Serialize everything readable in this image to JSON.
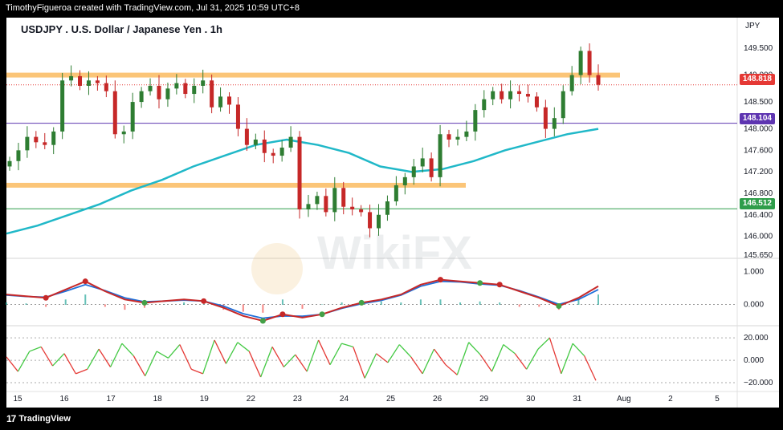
{
  "header": {
    "credit": "TimothyFigueroa created with TradingView.com, Jul 31, 2025 10:59 UTC+8"
  },
  "footer": {
    "logo_mark": "17",
    "logo_text": "TradingView"
  },
  "colors": {
    "bull": "#2e7d32",
    "bear": "#c62828",
    "ma": "#20b8c8",
    "zone": "#fbbf69",
    "purple": "#5e35b1",
    "green_line": "#2e9d4a",
    "current": "#e53935",
    "macd_blue": "#1e6fd9",
    "macd_red": "#c62828",
    "macd_green_dot": "#43a047",
    "rsi_green": "#43c943",
    "rsi_red": "#e53935"
  },
  "chart_data": {
    "type": "candlestick",
    "title": "USDJPY . U.S. Dollar / Japanese Yen . 1h",
    "currency": "JPY",
    "ylim": [
      145.65,
      149.8
    ],
    "y_ticks": [
      "149.500",
      "149.000",
      "148.500",
      "148.000",
      "147.600",
      "147.200",
      "146.800",
      "146.400",
      "146.000",
      "145.650"
    ],
    "x_ticks": [
      "15",
      "16",
      "17",
      "18",
      "19",
      "22",
      "23",
      "24",
      "25",
      "26",
      "29",
      "30",
      "31",
      "Aug",
      "2",
      "5"
    ],
    "price_labels": [
      {
        "name": "current",
        "value": "148.818"
      },
      {
        "name": "purple-line",
        "value": "148.104"
      },
      {
        "name": "green-line",
        "value": "146.512"
      }
    ],
    "zones": [
      {
        "name": "resistance-zone",
        "price": 149.0
      },
      {
        "name": "support-zone",
        "price": 146.95
      }
    ],
    "closes": [
      147.4,
      147.6,
      147.85,
      147.75,
      147.7,
      147.95,
      148.9,
      148.98,
      148.8,
      148.9,
      148.85,
      148.7,
      147.9,
      147.95,
      148.5,
      148.7,
      148.8,
      148.55,
      148.75,
      148.85,
      148.65,
      148.8,
      148.9,
      148.4,
      148.6,
      148.45,
      148.0,
      147.7,
      147.8,
      147.55,
      147.5,
      147.65,
      147.85,
      146.5,
      146.6,
      146.75,
      146.45,
      146.9,
      146.55,
      146.5,
      146.45,
      146.15,
      146.4,
      146.65,
      146.95,
      147.1,
      147.3,
      147.45,
      147.1,
      147.9,
      147.8,
      147.85,
      147.95,
      148.35,
      148.55,
      148.7,
      148.55,
      148.7,
      148.65,
      148.6,
      148.4,
      148.0,
      148.2,
      148.7,
      149.0,
      149.45,
      149.0,
      148.82
    ],
    "ma_values": [
      146.05,
      146.2,
      146.4,
      146.6,
      146.85,
      147.05,
      147.3,
      147.5,
      147.7,
      147.8,
      147.7,
      147.55,
      147.3,
      147.2,
      147.25,
      147.4,
      147.6,
      147.75,
      147.9,
      148.0
    ],
    "macd": {
      "ylim": [
        -0.5,
        1.3
      ],
      "y_ticks": [
        "1.000",
        "0.000"
      ],
      "fast": [
        0.3,
        0.25,
        0.2,
        0.45,
        0.7,
        0.4,
        0.15,
        0.05,
        0.1,
        0.15,
        0.1,
        -0.1,
        -0.35,
        -0.5,
        -0.3,
        -0.4,
        -0.3,
        -0.1,
        0.05,
        0.15,
        0.3,
        0.6,
        0.75,
        0.7,
        0.65,
        0.6,
        0.4,
        0.2,
        -0.05,
        0.2,
        0.55
      ],
      "slow": [
        0.28,
        0.24,
        0.22,
        0.4,
        0.6,
        0.42,
        0.2,
        0.08,
        0.1,
        0.13,
        0.1,
        -0.05,
        -0.28,
        -0.42,
        -0.35,
        -0.36,
        -0.3,
        -0.12,
        0.02,
        0.12,
        0.28,
        0.55,
        0.7,
        0.68,
        0.62,
        0.58,
        0.42,
        0.22,
        0.0,
        0.15,
        0.45
      ],
      "dots": [
        {
          "i": 2,
          "color": "red"
        },
        {
          "i": 4,
          "color": "red"
        },
        {
          "i": 7,
          "color": "green"
        },
        {
          "i": 10,
          "color": "red"
        },
        {
          "i": 13,
          "color": "green"
        },
        {
          "i": 14,
          "color": "red"
        },
        {
          "i": 16,
          "color": "green"
        },
        {
          "i": 18,
          "color": "green"
        },
        {
          "i": 22,
          "color": "red"
        },
        {
          "i": 24,
          "color": "green"
        },
        {
          "i": 25,
          "color": "red"
        },
        {
          "i": 28,
          "color": "green"
        }
      ]
    },
    "oscillator": {
      "ylim": [
        -25,
        28
      ],
      "y_ticks": [
        "20.000",
        "0.000",
        "−20.000"
      ],
      "values": [
        3,
        -10,
        8,
        12,
        -5,
        6,
        -12,
        -8,
        10,
        -6,
        15,
        4,
        -14,
        8,
        2,
        14,
        -8,
        -12,
        18,
        -3,
        16,
        8,
        -15,
        12,
        -6,
        5,
        -10,
        18,
        -4,
        15,
        12,
        -16,
        6,
        -2,
        14,
        3,
        -12,
        10,
        -4,
        -13,
        16,
        5,
        -10,
        14,
        6,
        -8,
        10,
        20,
        -12,
        15,
        4,
        -18
      ]
    }
  }
}
